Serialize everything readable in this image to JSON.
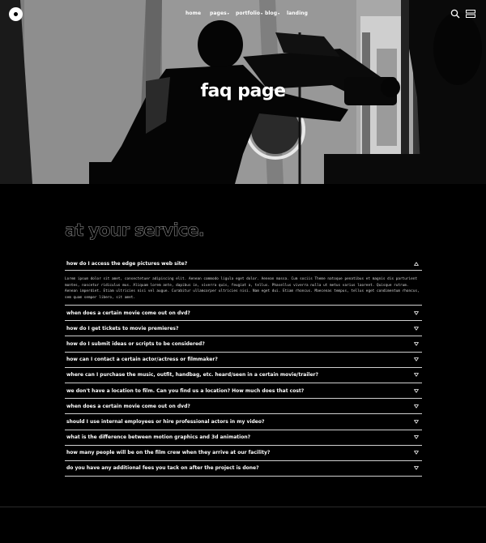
{
  "nav": {
    "items": [
      {
        "label": "home",
        "has_caret": false
      },
      {
        "label": "pages",
        "has_caret": true
      },
      {
        "label": "portfolio",
        "has_caret": true
      },
      {
        "label": "blog",
        "has_caret": true
      },
      {
        "label": "landing",
        "has_caret": false
      }
    ]
  },
  "hero": {
    "title": "faq page"
  },
  "section": {
    "heading": "at your service."
  },
  "faq": {
    "items": [
      {
        "question": "how do I access the edge pictures web site?",
        "open": true,
        "answer": "Lorem ipsum dolor sit amet, consectetuer adipiscing elit. Aenean commodo ligula eget dolor. Aenean massa. Cum sociis Theme natoque penatibus et magnis dis parturient montes, nascetur ridiculus mus. Aliquam lorem ante, dapibus in, viverra quis, feugiat a, tellus. Phasellus viverra nulla ut metus varius laoreet. Quisque rutrum. Aenean imperdiet. Etiam ultricies nisi vel augue. Curabitur ullamcorper ultricies nisi. Nam eget dui. Etiam rhoncus. Maecenas tempus, tellus eget condimentum rhoncus, sem quam semper libero, sit amet."
      },
      {
        "question": "when does a certain movie come out on dvd?",
        "open": false
      },
      {
        "question": "how do I get tickets to movie premieres?",
        "open": false
      },
      {
        "question": "how do I submit ideas or scripts to be considered?",
        "open": false
      },
      {
        "question": "how can I contact a certain actor/actress or filmmaker?",
        "open": false
      },
      {
        "question": "where can I purchase the music, outfit, handbag, etc. heard/seen in a certain movie/trailer?",
        "open": false
      },
      {
        "question": "we don't have a location to film. Can you find us a location? How much does that cost?",
        "open": false
      },
      {
        "question": "when does a certain movie come out on dvd?",
        "open": false
      },
      {
        "question": "should I use internal employees or hire professional actors in my video?",
        "open": false
      },
      {
        "question": "what is the difference between motion graphics and 3d animation?",
        "open": false
      },
      {
        "question": "how many people will be on the film crew when they arrive at our facility?",
        "open": false
      },
      {
        "question": "do you have any additional fees you tack on after the project is done?",
        "open": false
      }
    ]
  },
  "icons": {
    "logo": "circle-logo-icon",
    "search": "search-icon",
    "menu": "menu-icon",
    "open_chevron": "chevron-up-icon",
    "closed_chevron": "chevron-down-icon"
  }
}
